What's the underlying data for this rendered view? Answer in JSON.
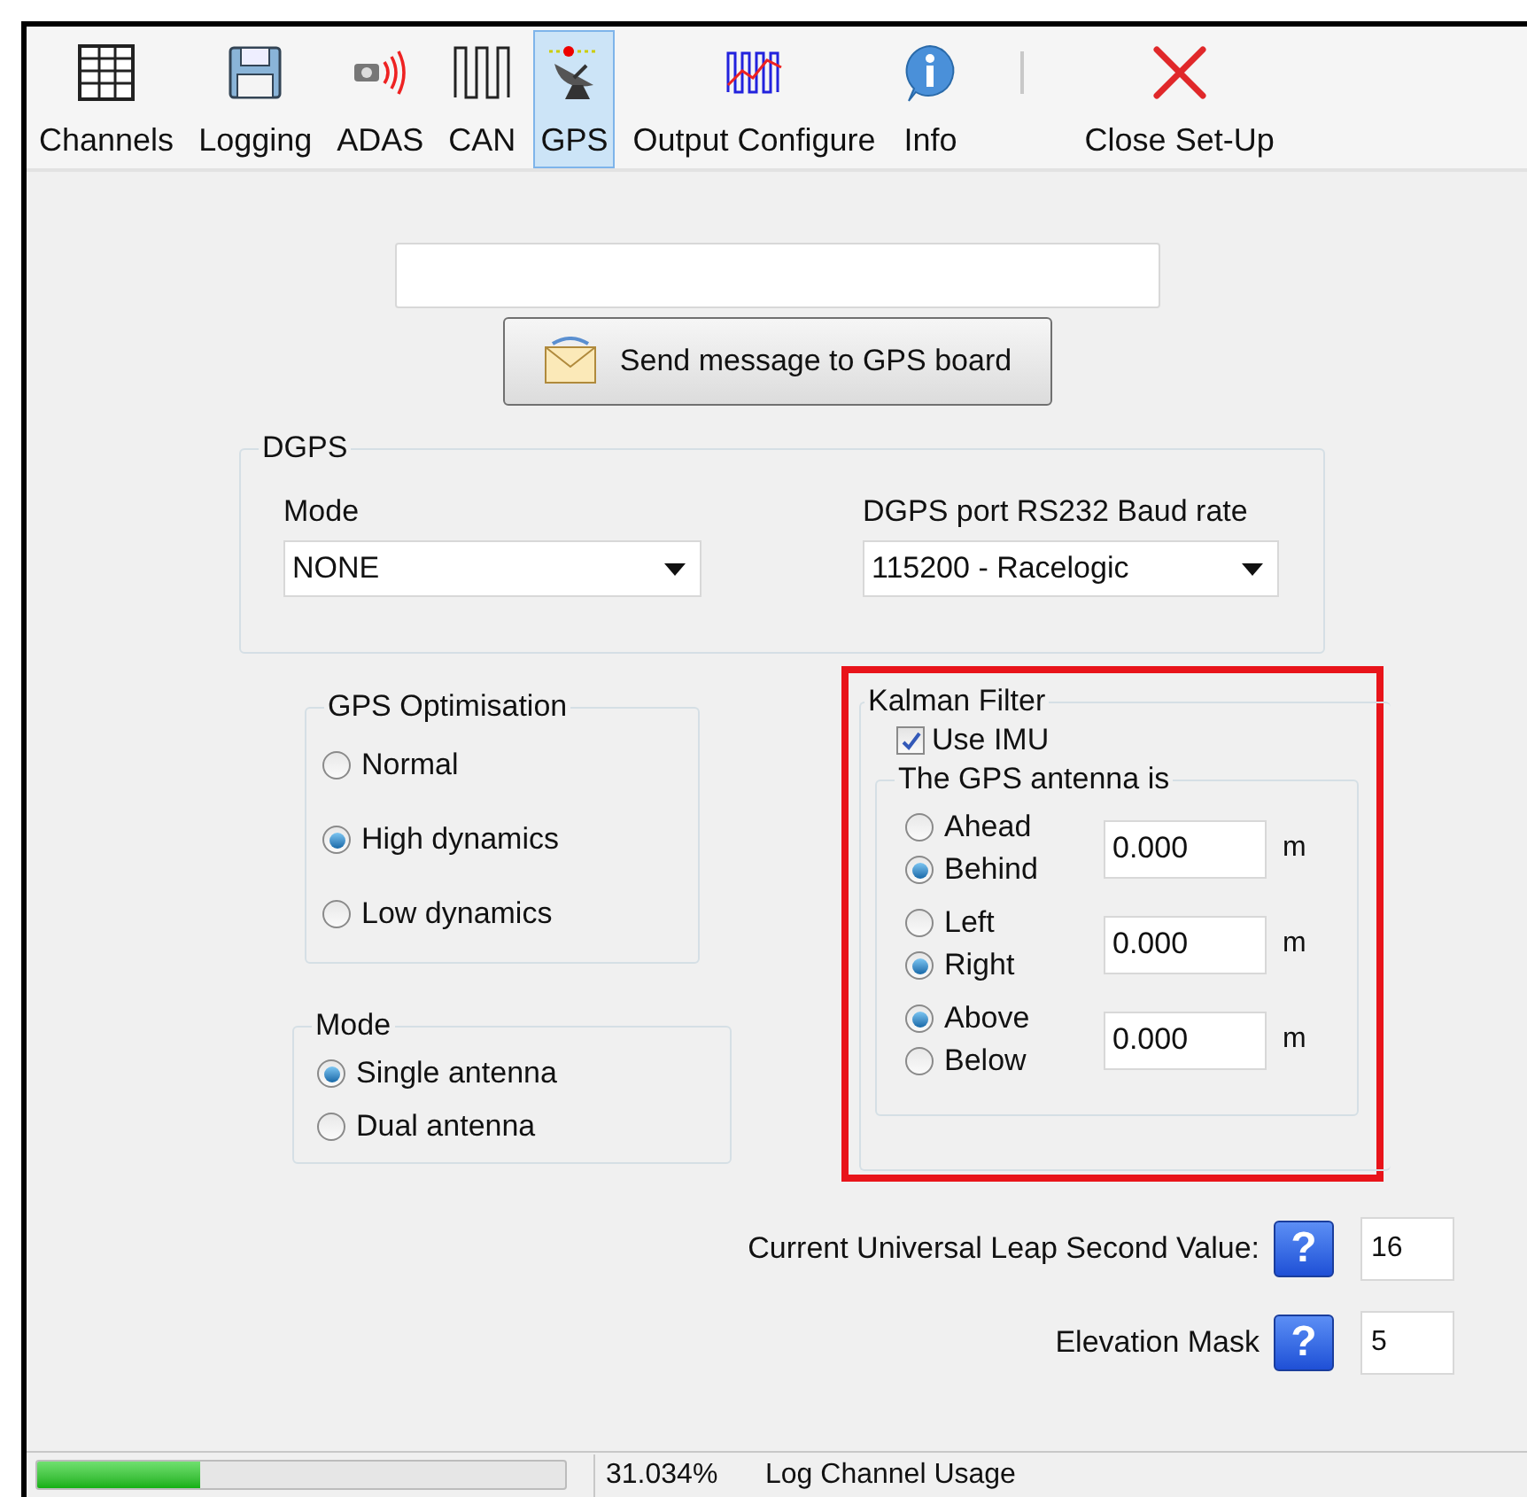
{
  "toolbar": {
    "items": [
      {
        "label": "Channels",
        "selected": false
      },
      {
        "label": "Logging",
        "selected": false
      },
      {
        "label": "ADAS",
        "selected": false
      },
      {
        "label": "CAN",
        "selected": false
      },
      {
        "label": "GPS",
        "selected": true
      },
      {
        "label": "Output Configure",
        "selected": false
      },
      {
        "label": "Info",
        "selected": false
      }
    ],
    "end_items": [
      {
        "label": "Close Set-Up",
        "selected": false
      }
    ]
  },
  "send_button": "Send message to GPS board",
  "dgps": {
    "title": "DGPS",
    "mode": {
      "label": "Mode",
      "value": "NONE"
    },
    "baud_rate": {
      "label": "DGPS port RS232 Baud rate",
      "value": "115200 - Racelogic"
    }
  },
  "gps_optimisation": {
    "title": "GPS Optimisation",
    "options": [
      {
        "label": "Normal",
        "selected": false
      },
      {
        "label": "High dynamics",
        "selected": true
      },
      {
        "label": "Low dynamics",
        "selected": false
      }
    ]
  },
  "antenna_mode": {
    "title": "Mode",
    "options": [
      {
        "label": "Single antenna",
        "selected": true
      },
      {
        "label": "Dual antenna",
        "selected": false
      }
    ]
  },
  "kalman_filter": {
    "title": "Kalman Filter",
    "highlighted": true,
    "use_imu": {
      "label": "Use IMU",
      "checked": true
    },
    "antenna_position": {
      "title": "The GPS antenna is",
      "axes": [
        {
          "options": [
            {
              "label": "Ahead",
              "selected": false
            },
            {
              "label": "Behind",
              "selected": true
            }
          ],
          "value": "0.000",
          "unit": "m"
        },
        {
          "options": [
            {
              "label": "Left",
              "selected": false
            },
            {
              "label": "Right",
              "selected": true
            }
          ],
          "value": "0.000",
          "unit": "m"
        },
        {
          "options": [
            {
              "label": "Above",
              "selected": true
            },
            {
              "label": "Below",
              "selected": false
            }
          ],
          "value": "0.000",
          "unit": "m"
        }
      ]
    }
  },
  "leap_second": {
    "label": "Current Universal Leap Second Value:",
    "help": "?",
    "value": "16"
  },
  "elevation_mask": {
    "label": "Elevation Mask",
    "help": "?",
    "value": "5"
  },
  "status_bar": {
    "usage": {
      "level": 0.31,
      "reading": "31.034%",
      "label": "Log Channel Usage"
    }
  }
}
